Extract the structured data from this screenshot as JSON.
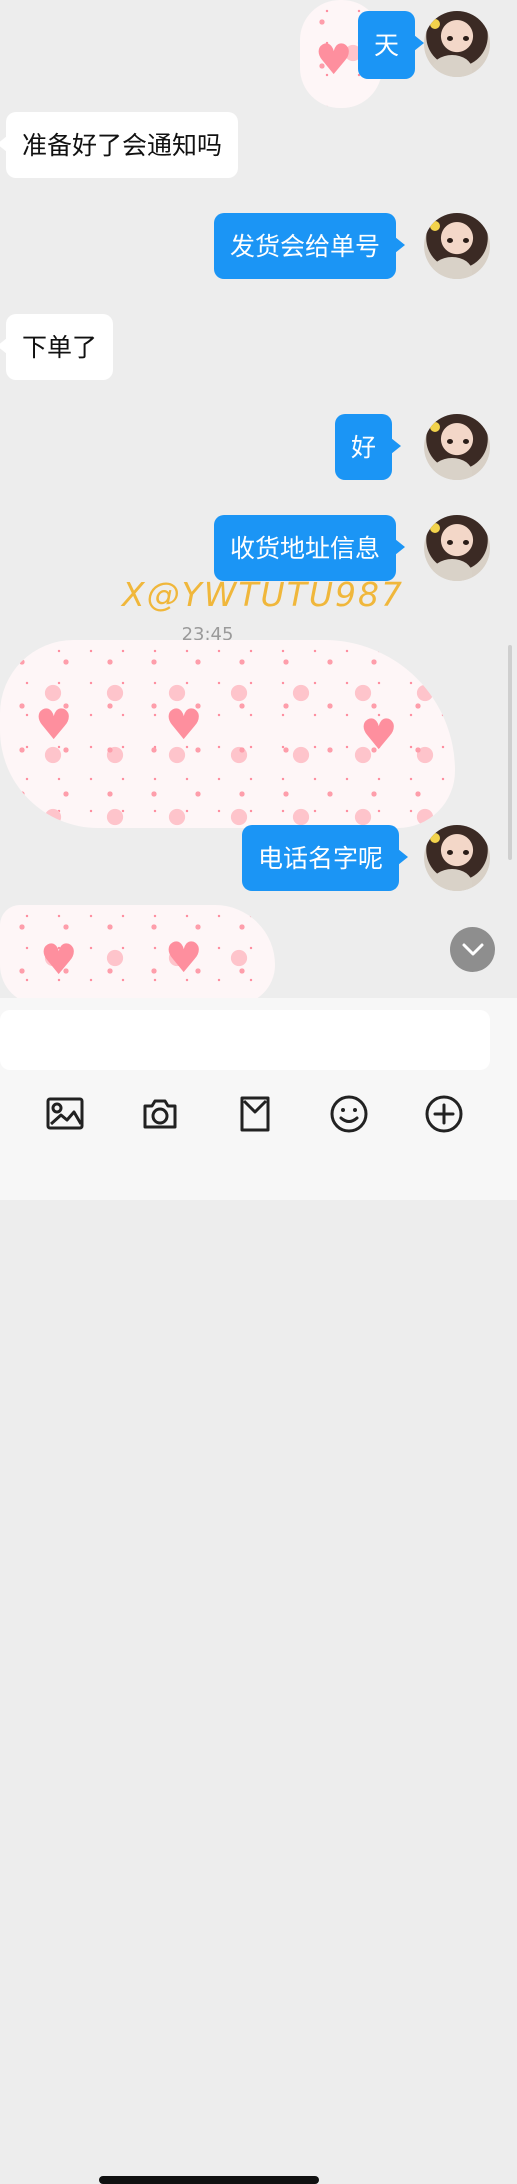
{
  "messages": [
    {
      "side": "out",
      "text": "天"
    },
    {
      "side": "in",
      "text": "准备好了会通知吗"
    },
    {
      "side": "out",
      "text": "发货会给单号"
    },
    {
      "side": "in",
      "text": "下单了"
    },
    {
      "side": "out",
      "text": "好"
    },
    {
      "side": "out",
      "text": "收货地址信息"
    },
    {
      "side": "out",
      "text": "电话名字呢"
    }
  ],
  "watermark": "X@YWTUTU987",
  "timestamp": "23:45",
  "icons": [
    "image-icon",
    "camera-icon",
    "bag-icon",
    "emoji-icon",
    "plus-icon"
  ],
  "colors": {
    "outgoing_bubble": "#1b95f5",
    "incoming_bubble": "#ffffff",
    "background": "#ededed"
  }
}
